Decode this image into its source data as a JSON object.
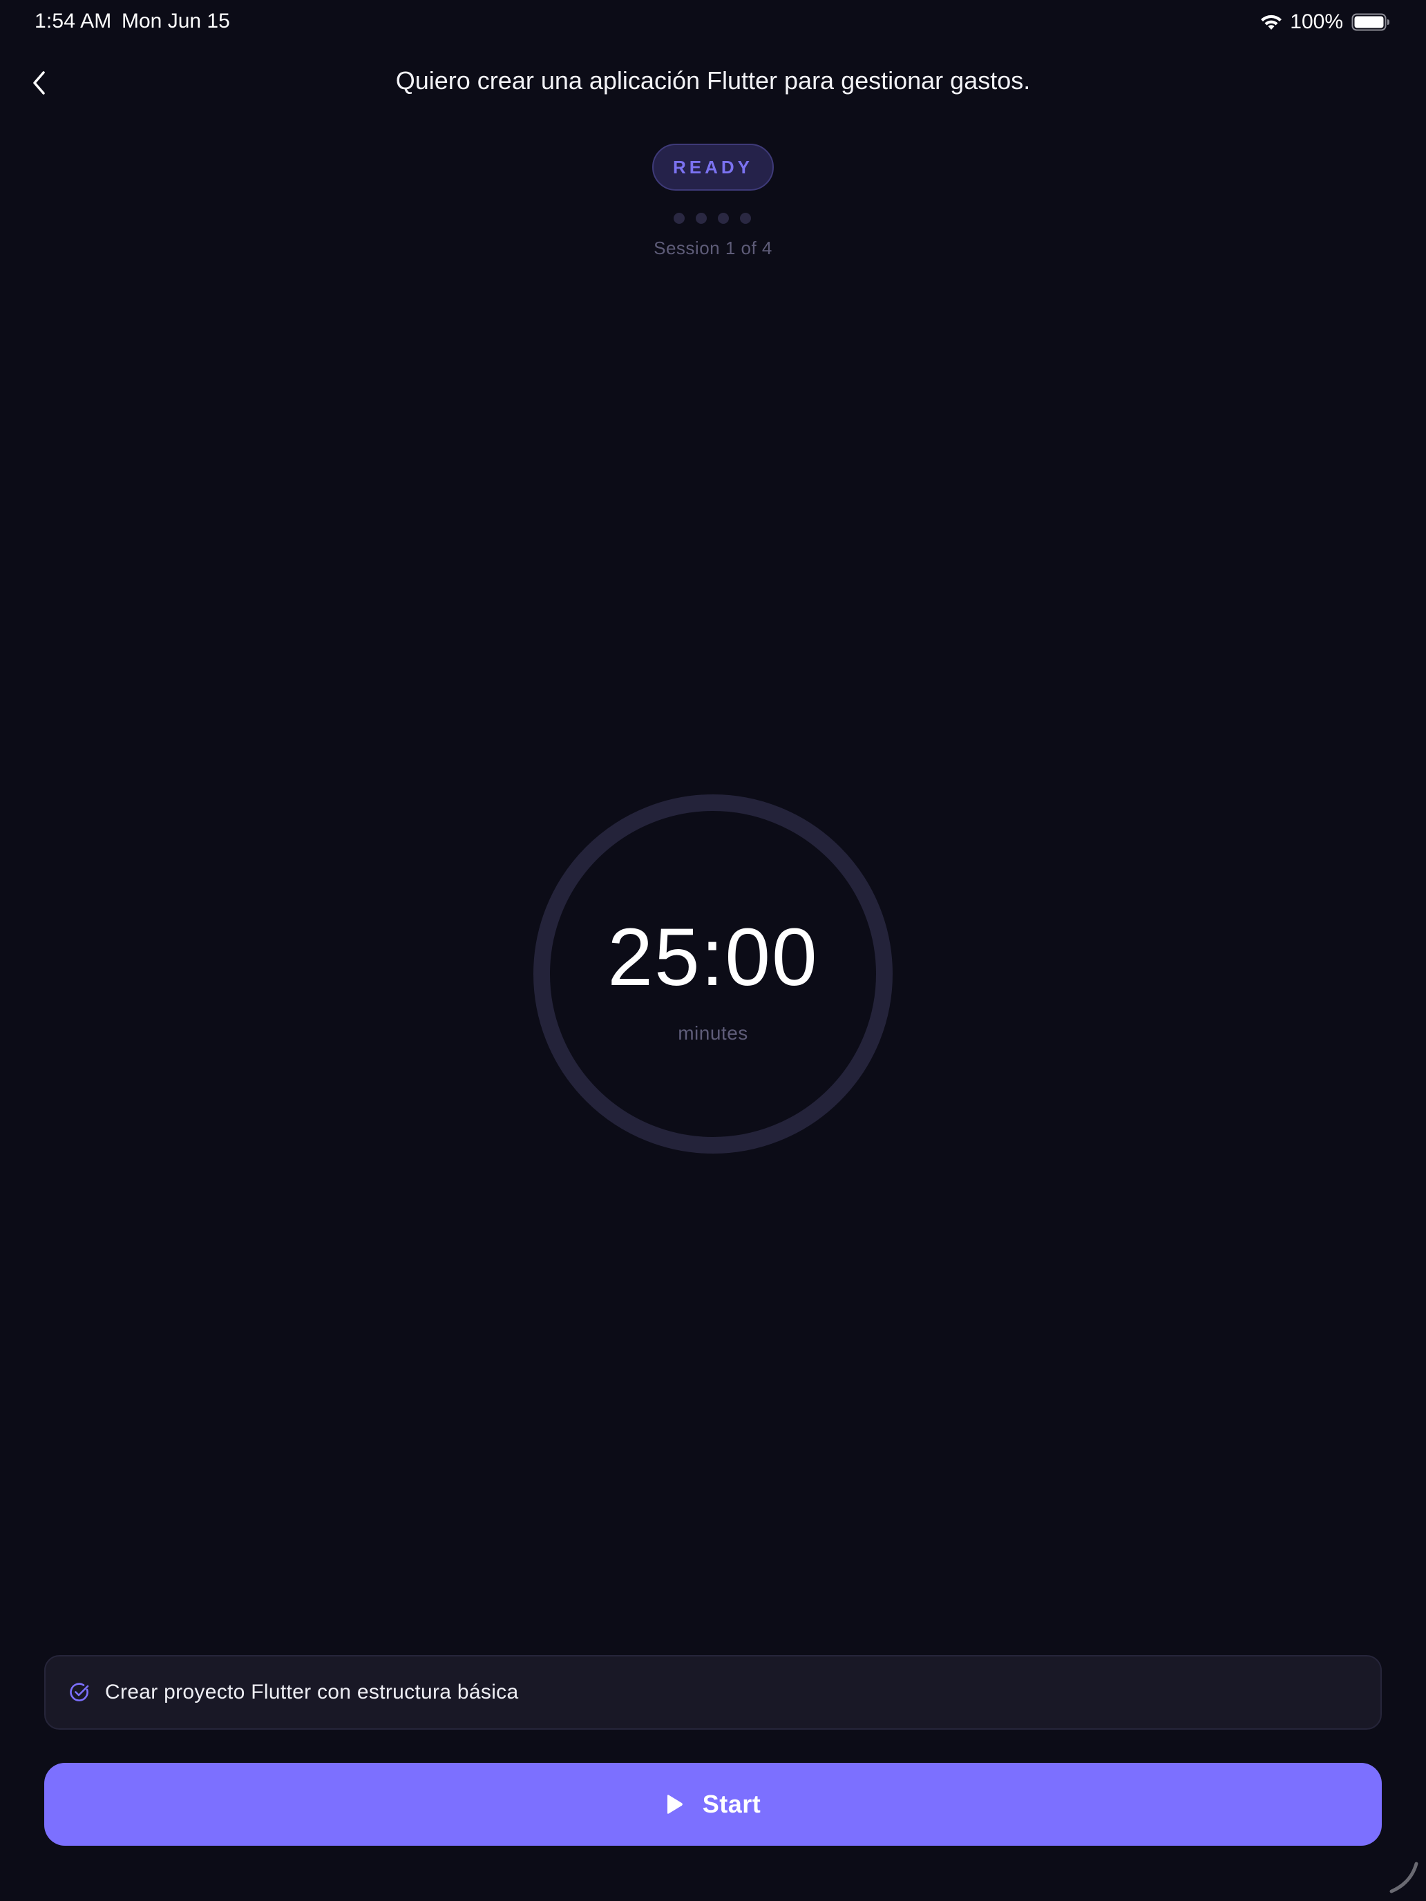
{
  "status_bar": {
    "time": "1:54 AM",
    "date": "Mon Jun 15",
    "battery_percent": "100%",
    "icons": [
      "wifi-icon",
      "battery-icon"
    ]
  },
  "header": {
    "title": "Quiero crear una aplicación Flutter para gestionar gastos.",
    "back_icon": "chevron-left-icon"
  },
  "session": {
    "status": "READY",
    "current": 1,
    "total": 4,
    "label": "Session 1 of 4"
  },
  "timer": {
    "value": "25:00",
    "unit": "minutes",
    "progress": 0
  },
  "task": {
    "icon": "check-circle-icon",
    "text": "Crear proyecto Flutter con estructura básica"
  },
  "start_button": {
    "icon": "play-icon",
    "label": "Start"
  },
  "colors": {
    "background": "#0c0c17",
    "accent": "#7c70ff",
    "pill_text": "#7b72f0",
    "muted_text": "#5e5c78",
    "ring": "#24233a",
    "card": "#191826"
  }
}
